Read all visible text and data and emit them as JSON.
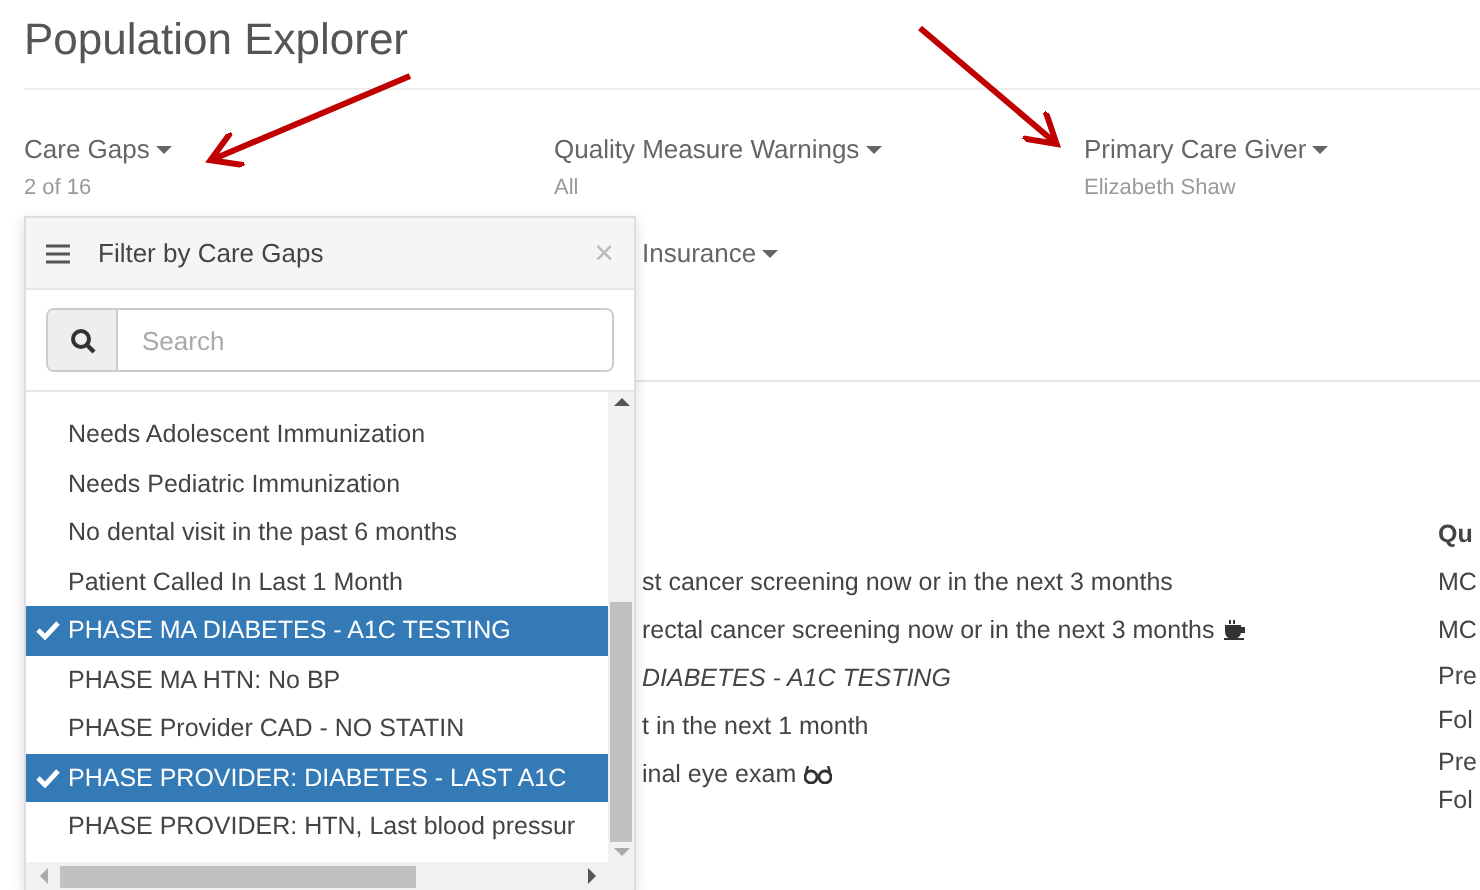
{
  "title": "Population Explorer",
  "filters": [
    {
      "label": "Care Gaps",
      "value": "2 of 16"
    },
    {
      "label": "Quality Measure Warnings",
      "value": "All"
    },
    {
      "label": "Primary Care Giver",
      "value": "Elizabeth Shaw"
    },
    {
      "label": "Insurance"
    }
  ],
  "dropdown": {
    "title": "Filter by Care Gaps",
    "close": "×",
    "search": {
      "placeholder": "Search"
    },
    "items": [
      {
        "label": "Needs Adolescent Immunization",
        "selected": false
      },
      {
        "label": "Needs Pediatric Immunization",
        "selected": false
      },
      {
        "label": "No dental visit in the past 6 months",
        "selected": false
      },
      {
        "label": "Patient Called In Last 1 Month",
        "selected": false
      },
      {
        "label": "PHASE MA DIABETES - A1C TESTING",
        "selected": true
      },
      {
        "label": "PHASE MA HTN: No BP",
        "selected": false
      },
      {
        "label": "PHASE Provider CAD - NO STATIN",
        "selected": false
      },
      {
        "label": "PHASE PROVIDER: DIABETES - LAST A1C",
        "selected": true
      },
      {
        "label": "PHASE PROVIDER: HTN, Last blood pressur",
        "selected": false
      }
    ]
  },
  "content": {
    "rows": [
      {
        "text": "st cancer screening now or in the next 3 months",
        "italic": false
      },
      {
        "text": "rectal cancer screening now or in the next 3 months",
        "italic": false
      },
      {
        "text": "DIABETES - A1C TESTING",
        "italic": true
      },
      {
        "text": "t in the next 1 month",
        "italic": false
      },
      {
        "text": "inal eye exam",
        "italic": false
      }
    ],
    "side_column": {
      "heading": "Qu",
      "cells": [
        "MC",
        "MC",
        "Pre",
        "Fol",
        "Pre",
        "Fol"
      ]
    }
  }
}
